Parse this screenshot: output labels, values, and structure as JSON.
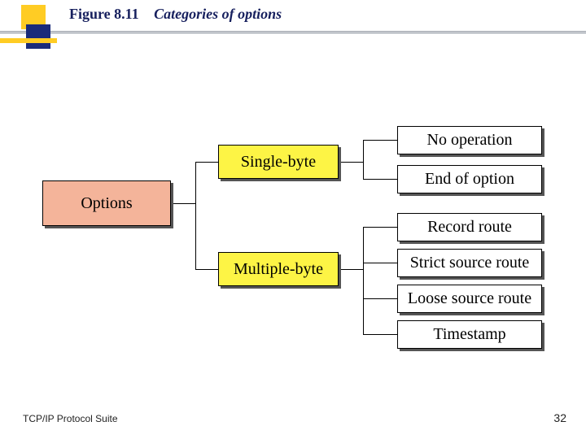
{
  "header": {
    "figure_label": "Figure 8.11",
    "caption": "Categories of options"
  },
  "footer": {
    "left": "TCP/IP Protocol Suite",
    "page": "32"
  },
  "diagram": {
    "root": "Options",
    "single": {
      "label": "Single-byte",
      "leaves": [
        "No operation",
        "End of option"
      ]
    },
    "multiple": {
      "label": "Multiple-byte",
      "leaves": [
        "Record route",
        "Strict source route",
        "Loose source route",
        "Timestamp"
      ]
    }
  }
}
